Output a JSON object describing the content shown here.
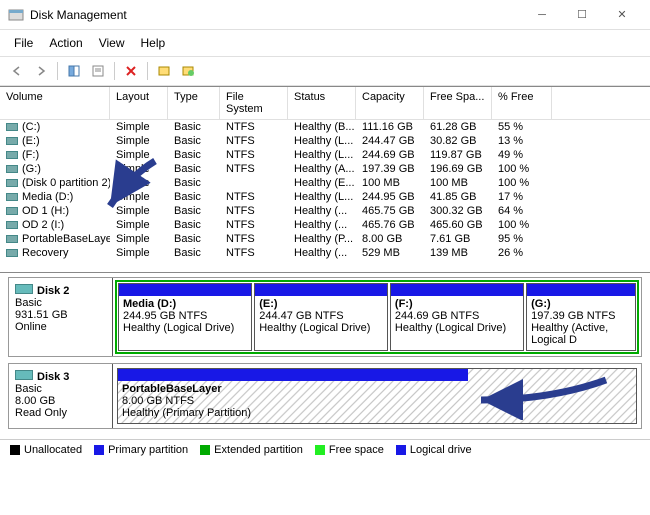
{
  "window": {
    "title": "Disk Management"
  },
  "menu": {
    "file": "File",
    "action": "Action",
    "view": "View",
    "help": "Help"
  },
  "columns": {
    "volume": "Volume",
    "layout": "Layout",
    "type": "Type",
    "fs": "File System",
    "status": "Status",
    "capacity": "Capacity",
    "free": "Free Spa...",
    "pct": "% Free"
  },
  "volumes": [
    {
      "name": "(C:)",
      "layout": "Simple",
      "type": "Basic",
      "fs": "NTFS",
      "status": "Healthy (B...",
      "cap": "111.16 GB",
      "free": "61.28 GB",
      "pct": "55 %"
    },
    {
      "name": "(E:)",
      "layout": "Simple",
      "type": "Basic",
      "fs": "NTFS",
      "status": "Healthy (L...",
      "cap": "244.47 GB",
      "free": "30.82 GB",
      "pct": "13 %"
    },
    {
      "name": "(F:)",
      "layout": "Simple",
      "type": "Basic",
      "fs": "NTFS",
      "status": "Healthy (L...",
      "cap": "244.69 GB",
      "free": "119.87 GB",
      "pct": "49 %"
    },
    {
      "name": "(G:)",
      "layout": "Simple",
      "type": "Basic",
      "fs": "NTFS",
      "status": "Healthy (A...",
      "cap": "197.39 GB",
      "free": "196.69 GB",
      "pct": "100 %"
    },
    {
      "name": "(Disk 0 partition 2)",
      "layout": "Simple",
      "type": "Basic",
      "fs": "",
      "status": "Healthy (E...",
      "cap": "100 MB",
      "free": "100 MB",
      "pct": "100 %"
    },
    {
      "name": "Media (D:)",
      "layout": "Simple",
      "type": "Basic",
      "fs": "NTFS",
      "status": "Healthy (L...",
      "cap": "244.95 GB",
      "free": "41.85 GB",
      "pct": "17 %"
    },
    {
      "name": "OD 1 (H:)",
      "layout": "Simple",
      "type": "Basic",
      "fs": "NTFS",
      "status": "Healthy (...",
      "cap": "465.75 GB",
      "free": "300.32 GB",
      "pct": "64 %"
    },
    {
      "name": "OD 2 (I:)",
      "layout": "Simple",
      "type": "Basic",
      "fs": "NTFS",
      "status": "Healthy (...",
      "cap": "465.76 GB",
      "free": "465.60 GB",
      "pct": "100 %"
    },
    {
      "name": "PortableBaseLayer",
      "layout": "Simple",
      "type": "Basic",
      "fs": "NTFS",
      "status": "Healthy (P...",
      "cap": "8.00 GB",
      "free": "7.61 GB",
      "pct": "95 %"
    },
    {
      "name": "Recovery",
      "layout": "Simple",
      "type": "Basic",
      "fs": "NTFS",
      "status": "Healthy (...",
      "cap": "529 MB",
      "free": "139 MB",
      "pct": "26 %"
    }
  ],
  "disks": {
    "d2": {
      "title": "Disk 2",
      "type": "Basic",
      "size": "931.51 GB",
      "state": "Online",
      "parts": [
        {
          "name": "Media  (D:)",
          "line2": "244.95 GB NTFS",
          "line3": "Healthy (Logical Drive)"
        },
        {
          "name": "(E:)",
          "line2": "244.47 GB NTFS",
          "line3": "Healthy (Logical Drive)"
        },
        {
          "name": "(F:)",
          "line2": "244.69 GB NTFS",
          "line3": "Healthy (Logical Drive)"
        },
        {
          "name": "(G:)",
          "line2": "197.39 GB NTFS",
          "line3": "Healthy (Active, Logical D"
        }
      ]
    },
    "d3": {
      "title": "Disk 3",
      "type": "Basic",
      "size": "8.00 GB",
      "state": "Read Only",
      "part": {
        "name": "PortableBaseLayer",
        "line2": "8.00 GB NTFS",
        "line3": "Healthy (Primary Partition)"
      }
    }
  },
  "legend": {
    "unalloc": "Unallocated",
    "primary": "Primary partition",
    "ext": "Extended partition",
    "free": "Free space",
    "logical": "Logical drive"
  }
}
